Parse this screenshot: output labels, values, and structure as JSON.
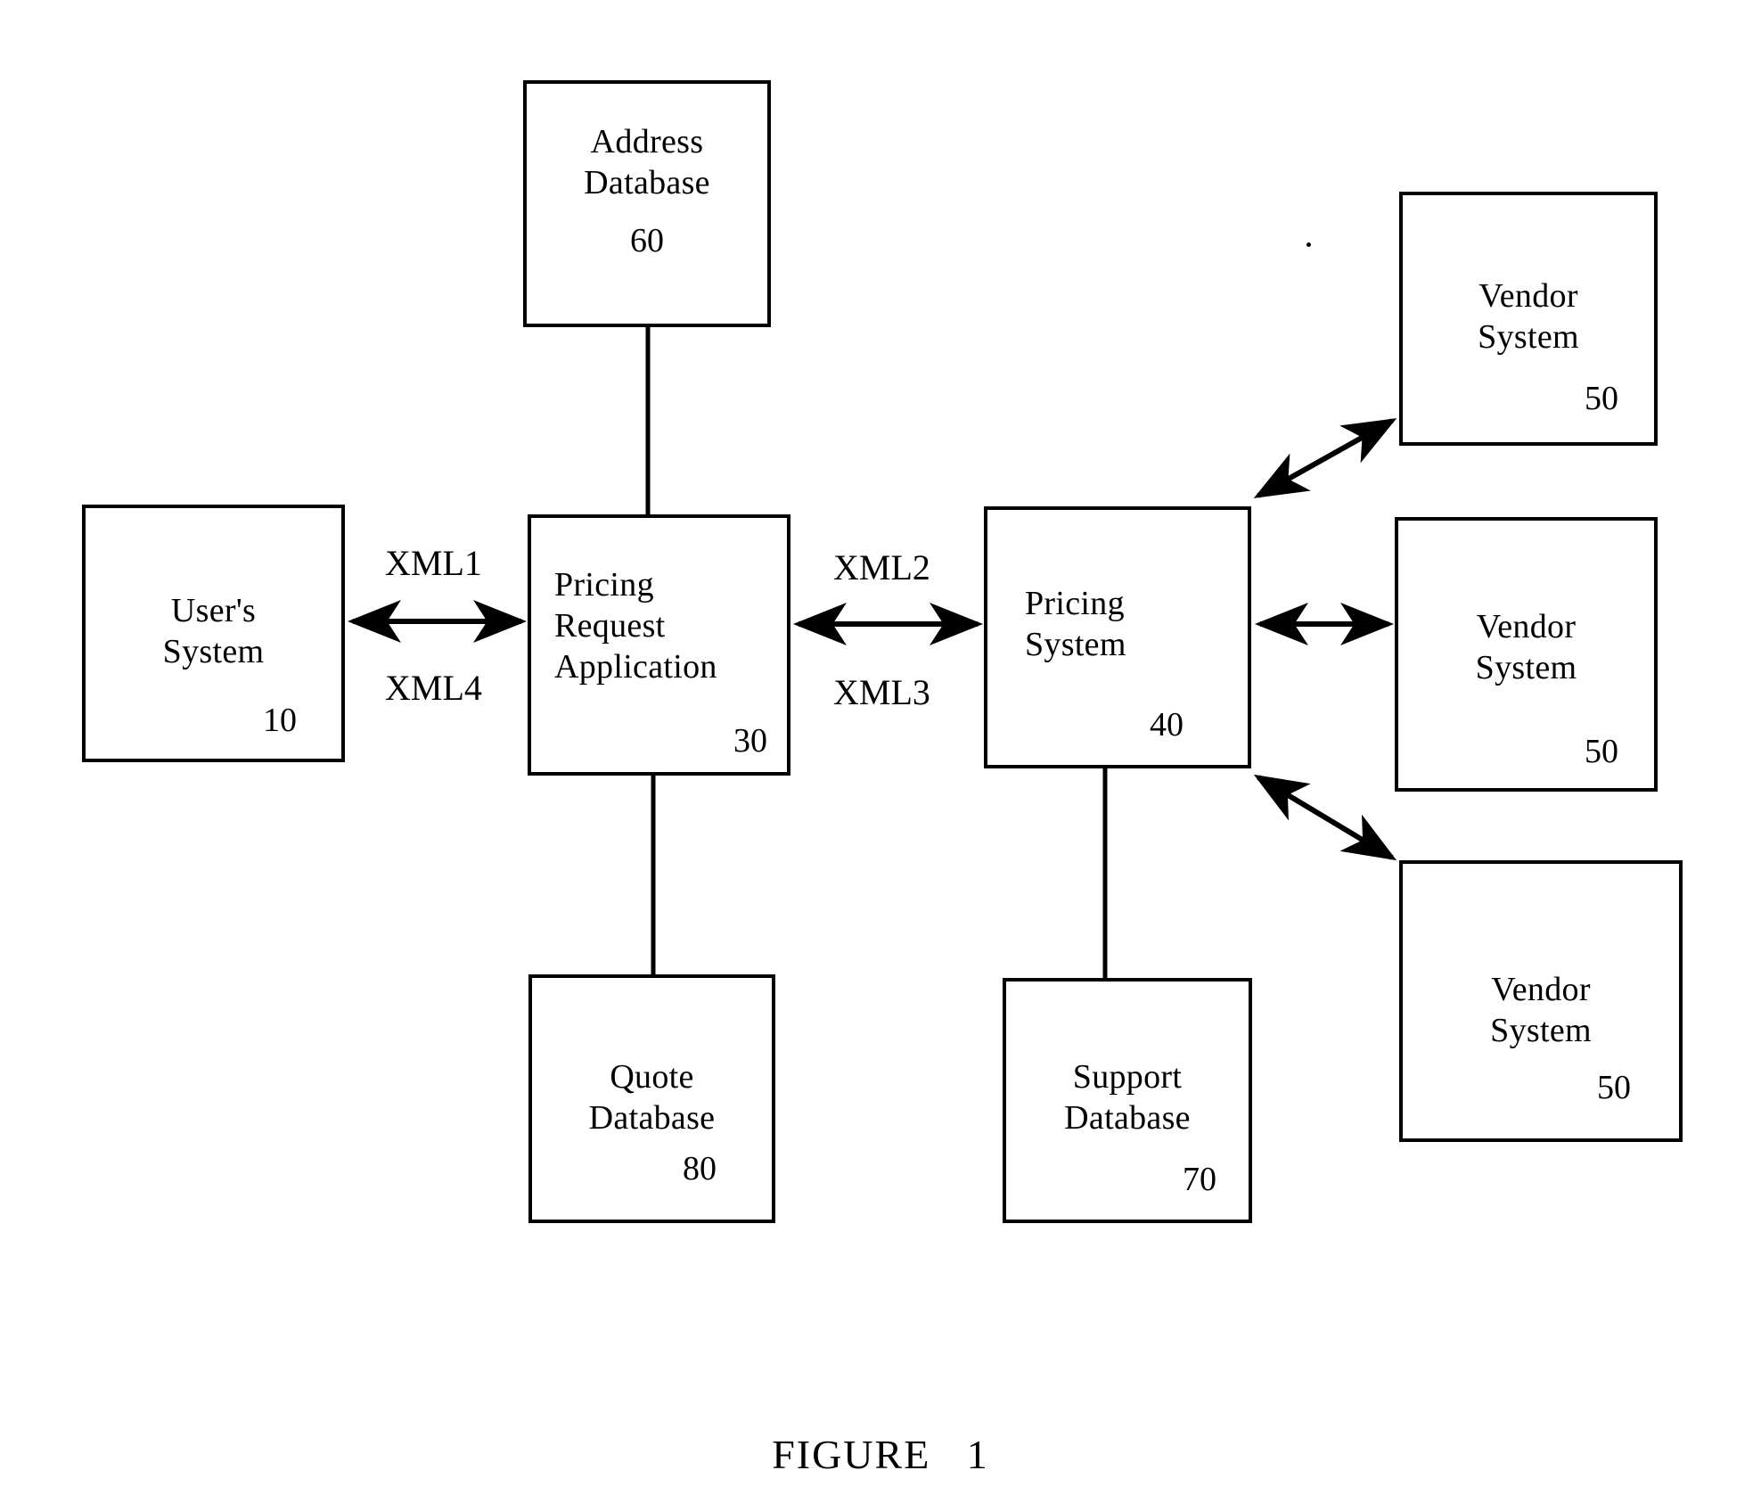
{
  "figure": {
    "caption": "FIGURE   1"
  },
  "nodes": [
    {
      "id": "address-database",
      "title": "Address\nDatabase",
      "ref": "60"
    },
    {
      "id": "users-system",
      "title": "User's\nSystem",
      "ref": "10"
    },
    {
      "id": "pricing-request-application",
      "title": "Pricing\nRequest\nApplication",
      "ref": "30"
    },
    {
      "id": "pricing-system",
      "title": "Pricing\nSystem",
      "ref": "40"
    },
    {
      "id": "quote-database",
      "title": "Quote\nDatabase",
      "ref": "80"
    },
    {
      "id": "support-database",
      "title": "Support\nDatabase",
      "ref": "70"
    },
    {
      "id": "vendor-system-top",
      "title": "Vendor\nSystem",
      "ref": "50"
    },
    {
      "id": "vendor-system-middle",
      "title": "Vendor\nSystem",
      "ref": "50"
    },
    {
      "id": "vendor-system-bottom",
      "title": "Vendor\nSystem",
      "ref": "50"
    }
  ],
  "edge_labels": {
    "xml1": "XML1",
    "xml4": "XML4",
    "xml2": "XML2",
    "xml3": "XML3"
  },
  "colors": {
    "ink": "#000000",
    "paper": "#ffffff"
  }
}
